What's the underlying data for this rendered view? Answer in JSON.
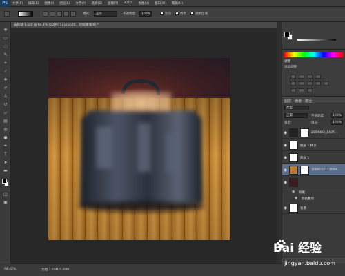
{
  "app": {
    "logo": "Ps"
  },
  "menu": [
    "文件(F)",
    "编辑(E)",
    "图像(I)",
    "图层(L)",
    "文字(Y)",
    "选择(S)",
    "滤镜(T)",
    "3D(D)",
    "视图(V)",
    "窗口(W)",
    "帮助(H)"
  ],
  "options_bar": {
    "mode_label": "模式:",
    "mode_value": "正常",
    "opacity_label": "不透明度:",
    "opacity_value": "100%",
    "reverse_label": "反向",
    "dither_label": "仿色",
    "transparency_label": "透明区域"
  },
  "document": {
    "tab_title": "未标题-1.psd @ 64.4% (1009152172504... 图层蒙版/8) *"
  },
  "adjustments": {
    "title": "调整",
    "add_label": "添加调整"
  },
  "layers_panel": {
    "tabs": [
      "图层",
      "通道",
      "路径"
    ],
    "kind_filter": "类型",
    "blend_mode": "正常",
    "opacity_label": "不透明度:",
    "opacity_value": "100%",
    "lock_label": "锁定:",
    "fill_label": "填充:",
    "fill_value": "100%",
    "layers": [
      {
        "name": "2054d03_1407...",
        "has_mask": true,
        "selected": false
      },
      {
        "name": "图层 1 拷贝",
        "has_mask": false,
        "selected": false
      },
      {
        "name": "图层 1",
        "has_mask": false,
        "selected": false
      },
      {
        "name": "1009152172504...",
        "has_mask": true,
        "selected": true
      },
      {
        "name": "",
        "has_mask": false,
        "selected": false
      }
    ],
    "effects_label": "效果",
    "effect_item": "颜色叠加",
    "background_layer": "背景"
  },
  "status_bar": {
    "zoom": "64.42%",
    "doc_info": "文档:3.00M/5.49M"
  },
  "watermark": {
    "logo_text": "Bai 经验",
    "url": "jingyan.baidu.com"
  },
  "colors": {
    "selected_layer": "#5b6f8c",
    "panel_bg": "#3a3a3a"
  }
}
